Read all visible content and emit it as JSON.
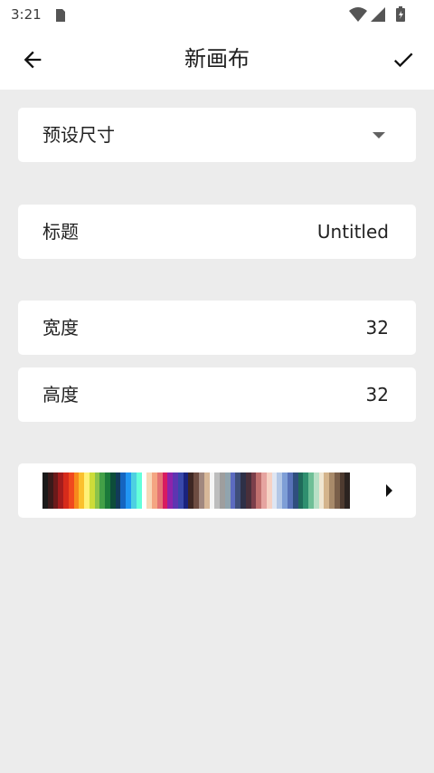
{
  "status_bar": {
    "time": "3:21"
  },
  "app_bar": {
    "title": "新画布"
  },
  "preset": {
    "label": "预设尺寸"
  },
  "title_field": {
    "label": "标题",
    "value": "Untitled"
  },
  "width_field": {
    "label": "宽度",
    "value": "32"
  },
  "height_field": {
    "label": "高度",
    "value": "32"
  },
  "palette": {
    "colors": [
      "#1a1a1a",
      "#3a1a1a",
      "#6b1a1a",
      "#a31d1d",
      "#d62b1b",
      "#f0491e",
      "#f7891c",
      "#fbc02d",
      "#fff176",
      "#cddc39",
      "#8bc34a",
      "#43a047",
      "#1b7a3a",
      "#0d4d3a",
      "#123a5a",
      "#1565c0",
      "#2196f3",
      "#4dd0e1",
      "#64ffda",
      "#ffffff",
      "#f8d7b8",
      "#f4a582",
      "#e57373",
      "#d81b60",
      "#8e24aa",
      "#5e35b1",
      "#3949ab",
      "#1a237e",
      "#3e2723",
      "#6d4c41",
      "#a1887f",
      "#d7b899",
      "#f5f5f5",
      "#bdbdbd",
      "#9e9e9e",
      "#90a4ae",
      "#5c6bc0",
      "#3f4f7a",
      "#2e3047",
      "#4a2f3a",
      "#7b3f4a",
      "#c0706e",
      "#e6a4a0",
      "#f6d2c4",
      "#dfe6f2",
      "#b3c7e6",
      "#7e9ed6",
      "#5872b8",
      "#2f4e7e",
      "#1f6b5a",
      "#2f8f6f",
      "#6fbf96",
      "#b8e0c6",
      "#f0e6d2",
      "#d4b48c",
      "#a88a6a",
      "#7a5f4a",
      "#4e3b30",
      "#2b2320"
    ]
  },
  "colors": {
    "background": "#ececec",
    "card": "#ffffff",
    "text": "#222222"
  },
  "icons": {
    "back": "arrow-left",
    "confirm": "check",
    "dropdown": "triangle-down",
    "expand": "triangle-right"
  }
}
